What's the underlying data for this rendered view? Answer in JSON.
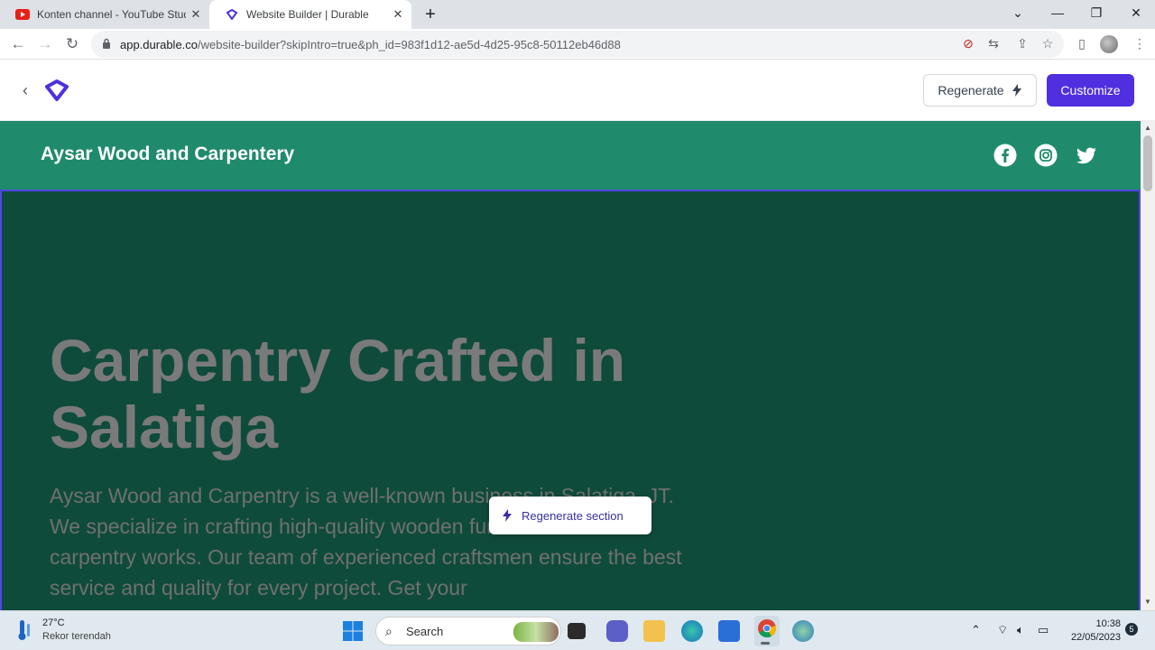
{
  "browser": {
    "tabs": [
      {
        "title": "Konten channel - YouTube Studio",
        "icon": "youtube-icon"
      },
      {
        "title": "Website Builder | Durable",
        "icon": "durable-icon",
        "active": true
      }
    ],
    "url_host": "app.durable.co",
    "url_path": "/website-builder?skipIntro=true&ph_id=983f1d12-ae5d-4d25-95c8-50112eb46d88"
  },
  "app": {
    "regenerate_label": "Regenerate",
    "customize_label": "Customize",
    "accent": "#4f2fe0"
  },
  "site": {
    "brand": "Aysar Wood and Carpentery",
    "social": [
      "facebook-icon",
      "instagram-icon",
      "twitter-icon"
    ],
    "header_color": "#1f8b6c",
    "hero_color": "#0f4b3b",
    "hero_title": "Carpentry Crafted in Salatiga",
    "hero_text": "Aysar Wood and Carpentry is a well-known business in Salatiga, JT. We specialize in crafting high-quality wooden furniture and other carpentry works. Our team of experienced craftsmen ensure the best service and quality for every project. Get your",
    "regenerate_section_label": "Regenerate section"
  },
  "taskbar": {
    "temperature": "27°C",
    "weather_note": "Rekor terendah",
    "search_label": "Search",
    "time": "10:38",
    "date": "22/05/2023",
    "notifications": "5"
  }
}
